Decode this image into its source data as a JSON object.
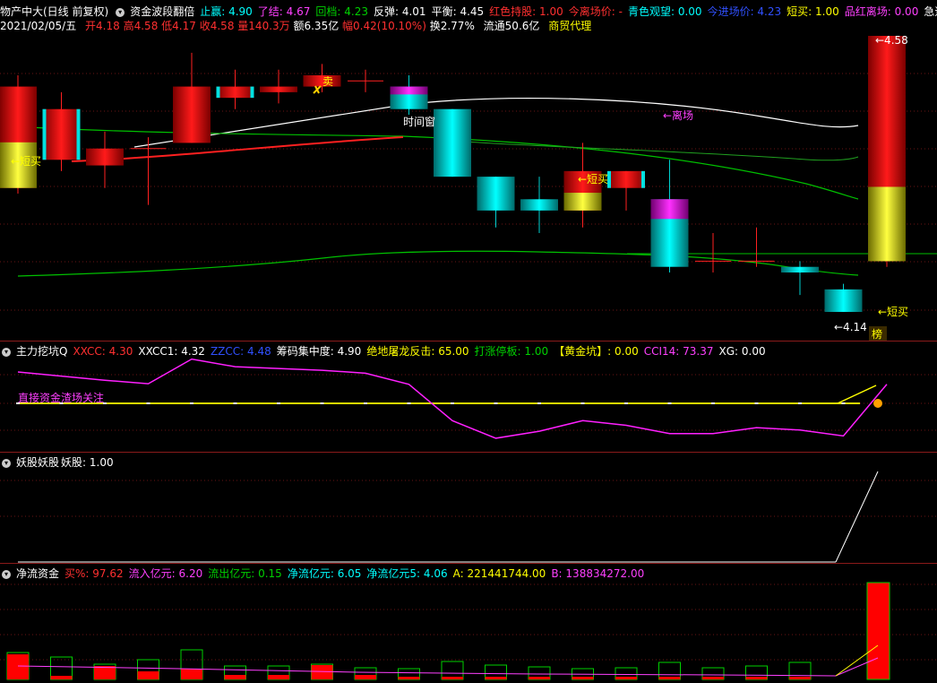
{
  "header": {
    "title": "物产中大(日线 前复权)",
    "indicator": "资金波段翻倍",
    "items": [
      {
        "label": "止赢:",
        "value": "4.90",
        "color": "#00ffff"
      },
      {
        "label": "了结:",
        "value": "4.67",
        "color": "#ff40ff"
      },
      {
        "label": "回档:",
        "value": "4.23",
        "color": "#00d000"
      },
      {
        "label": "反弹:",
        "value": "4.01",
        "color": "#ffffff"
      },
      {
        "label": "平衡:",
        "value": "4.45",
        "color": "#ffffff"
      },
      {
        "label": "红色持股:",
        "value": "1.00",
        "color": "#ff3030"
      },
      {
        "label": "今离场价:",
        "value": "-",
        "color": "#ff3030"
      },
      {
        "label": "青色观望:",
        "value": "0.00",
        "color": "#00ffff"
      },
      {
        "label": "今进场价:",
        "value": "4.23",
        "color": "#3050ff"
      },
      {
        "label": "短买:",
        "value": "1.00",
        "color": "#ffff00"
      },
      {
        "label": "品红离场:",
        "value": "0.00",
        "color": "#ff40ff"
      },
      {
        "label": "急速超跌",
        "value": "",
        "color": "#ffffff"
      }
    ]
  },
  "quote": {
    "date": "2021/02/05/五",
    "open": "开4.18",
    "high": "高4.58",
    "low": "低4.17",
    "close": "收4.58",
    "volume": "量140.3万",
    "amount": "额6.35亿",
    "change": "幅0.42(10.10%)",
    "turnover": "换2.77%",
    "float": "流通50.6亿",
    "sector": "商贸代理"
  },
  "main_chart": {
    "annotations": {
      "short_buy": "←短买",
      "sell": "卖",
      "time_window": "时间窗",
      "leave": "←离场",
      "price_high": "←4.58",
      "price_low": "←4.14",
      "board": "榜"
    },
    "candles": [
      {
        "o": 4.49,
        "c": 4.31,
        "h": 4.51,
        "l": 4.3,
        "style": "red_yellow"
      },
      {
        "o": 4.36,
        "c": 4.45,
        "h": 4.48,
        "l": 4.34,
        "style": "red_cyan"
      },
      {
        "o": 4.35,
        "c": 4.38,
        "h": 4.41,
        "l": 4.31,
        "style": "red"
      },
      {
        "o": 4.38,
        "c": 4.38,
        "h": 4.4,
        "l": 4.28,
        "style": "cross"
      },
      {
        "o": 4.39,
        "c": 4.49,
        "h": 4.55,
        "l": 4.39,
        "style": "red"
      },
      {
        "o": 4.47,
        "c": 4.49,
        "h": 4.52,
        "l": 4.45,
        "style": "red_cyan"
      },
      {
        "o": 4.48,
        "c": 4.49,
        "h": 4.52,
        "l": 4.46,
        "style": "red"
      },
      {
        "o": 4.49,
        "c": 4.51,
        "h": 4.53,
        "l": 4.48,
        "style": "red"
      },
      {
        "o": 4.5,
        "c": 4.5,
        "h": 4.52,
        "l": 4.48,
        "style": "cross"
      },
      {
        "o": 4.49,
        "c": 4.45,
        "h": 4.51,
        "l": 4.44,
        "style": "magenta_cyan"
      },
      {
        "o": 4.45,
        "c": 4.33,
        "h": 4.45,
        "l": 4.33,
        "style": "cyan"
      },
      {
        "o": 4.33,
        "c": 4.27,
        "h": 4.33,
        "l": 4.24,
        "style": "cyan"
      },
      {
        "o": 4.29,
        "c": 4.27,
        "h": 4.33,
        "l": 4.23,
        "style": "cyan"
      },
      {
        "o": 4.27,
        "c": 4.34,
        "h": 4.39,
        "l": 4.24,
        "style": "red_yellow"
      },
      {
        "o": 4.31,
        "c": 4.34,
        "h": 4.34,
        "l": 4.27,
        "style": "red_cyan"
      },
      {
        "o": 4.29,
        "c": 4.17,
        "h": 4.36,
        "l": 4.16,
        "style": "magenta_cyan"
      },
      {
        "o": 4.18,
        "c": 4.18,
        "h": 4.23,
        "l": 4.16,
        "style": "cross"
      },
      {
        "o": 4.18,
        "c": 4.18,
        "h": 4.24,
        "l": 4.17,
        "style": "cross"
      },
      {
        "o": 4.17,
        "c": 4.16,
        "h": 4.18,
        "l": 4.12,
        "style": "cyan"
      },
      {
        "o": 4.13,
        "c": 4.09,
        "h": 4.14,
        "l": 4.09,
        "style": "cyan"
      },
      {
        "o": 4.18,
        "c": 4.58,
        "h": 4.58,
        "l": 4.17,
        "style": "red_yellow"
      }
    ]
  },
  "panel2": {
    "title": "主力挖坑Q",
    "items": [
      {
        "label": "XXCC:",
        "value": "4.30",
        "color": "#ff3030"
      },
      {
        "label": "XXCC1:",
        "value": "4.32",
        "color": "#ffffff"
      },
      {
        "label": "ZZCC:",
        "value": "4.48",
        "color": "#3050ff"
      },
      {
        "label": "筹码集中度:",
        "value": "4.90",
        "color": "#ffffff"
      },
      {
        "label": "绝地屠龙反击:",
        "value": "65.00",
        "color": "#ffff00"
      },
      {
        "label": "打涨停板:",
        "value": "1.00",
        "color": "#00d000"
      },
      {
        "label": "【黄金坑】:",
        "value": "0.00",
        "color": "#ffff00"
      },
      {
        "label": "CCI14:",
        "value": "73.37",
        "color": "#ff40ff"
      },
      {
        "label": "XG:",
        "value": "0.00",
        "color": "#ffffff"
      }
    ],
    "note": "直接资金渣场关注",
    "line": [
      96.5,
      93,
      89.5,
      86.5,
      107.5,
      101,
      99.5,
      98,
      95.5,
      86,
      55,
      40,
      46,
      55,
      51,
      44,
      44,
      49,
      47,
      42,
      86
    ]
  },
  "panel3": {
    "title": "妖股妖股",
    "items": [
      {
        "label": "妖股:",
        "value": "1.00",
        "color": "#ffffff"
      }
    ],
    "line": [
      0,
      0,
      0,
      0,
      0,
      0,
      0,
      0,
      0,
      0,
      0,
      0,
      0,
      0,
      0,
      0,
      0,
      0,
      0,
      0,
      1
    ]
  },
  "panel4": {
    "title": "净流资金",
    "items": [
      {
        "label": "买%:",
        "value": "97.62",
        "color": "#ff3030"
      },
      {
        "label": "流入亿元:",
        "value": "6.20",
        "color": "#ff40ff"
      },
      {
        "label": "流出亿元:",
        "value": "0.15",
        "color": "#00d000"
      },
      {
        "label": "净流亿元:",
        "value": "6.05",
        "color": "#00ffff"
      },
      {
        "label": "净流亿元5:",
        "value": "4.06",
        "color": "#00ffff"
      },
      {
        "label": "A:",
        "value": "221441744.00",
        "color": "#ffff00"
      },
      {
        "label": "B:",
        "value": "138834272.00",
        "color": "#ff40ff"
      }
    ],
    "bars": [
      {
        "out": 30,
        "in": 28
      },
      {
        "out": 25,
        "in": 4
      },
      {
        "out": 17,
        "in": 15
      },
      {
        "out": 22,
        "in": 9
      },
      {
        "out": 33,
        "in": 12
      },
      {
        "out": 15,
        "in": 5
      },
      {
        "out": 15,
        "in": 5
      },
      {
        "out": 17,
        "in": 16
      },
      {
        "out": 13,
        "in": 5
      },
      {
        "out": 12,
        "in": 3
      },
      {
        "out": 20,
        "in": 3
      },
      {
        "out": 16,
        "in": 3
      },
      {
        "out": 14,
        "in": 3
      },
      {
        "out": 12,
        "in": 3
      },
      {
        "out": 13,
        "in": 3
      },
      {
        "out": 19,
        "in": 3
      },
      {
        "out": 13,
        "in": 3
      },
      {
        "out": 15,
        "in": 3
      },
      {
        "out": 19,
        "in": 3
      },
      {
        "out": 0,
        "in": 108
      }
    ]
  }
}
